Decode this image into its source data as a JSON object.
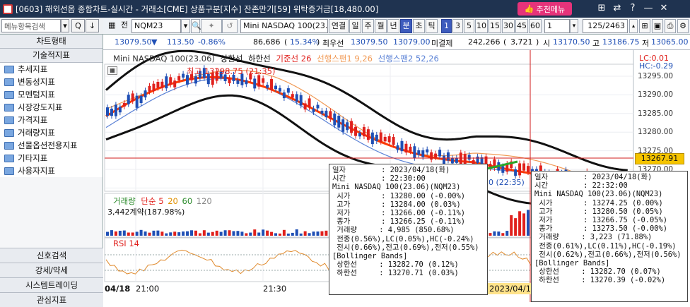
{
  "window": {
    "title": "[0603] 해외선옵 종합차트-실시간 - 거래소[CME] 상품구분[지수] 잔존만기[59] 위탁증거금[18,480.00]",
    "menu_button": "추천메뉴",
    "controls": [
      "⊞",
      "⇄",
      "?",
      "—",
      "✕"
    ]
  },
  "left_toolbar": {
    "search_placeholder": "메뉴항목검색",
    "buttons": [
      "▾",
      "Q",
      "↓"
    ]
  },
  "toolbar": {
    "type_label": "전",
    "symbol": "NQM23",
    "product_name": "Mini NASDAQ 100(23.06)",
    "period_buttons": [
      "연결",
      "일",
      "주",
      "월",
      "년",
      "분",
      "초",
      "틱"
    ],
    "selected_period": "분",
    "interval_buttons": [
      "1",
      "3",
      "5",
      "10",
      "15",
      "30",
      "45",
      "60"
    ],
    "selected_interval": "1",
    "interval_value": "1",
    "count": "125/2463"
  },
  "quote": {
    "price": "13079.50",
    "change": "113.50",
    "change_pct": "-0.86%",
    "volume": "86,686",
    "vol_ratio": "15.34%",
    "best_bid_label": "최우선",
    "best_bid": "13079.50",
    "best_ask": "13079.00",
    "open_interest_label": "미결제",
    "open_interest": "242,266",
    "oi_change": "3,721",
    "open_label": "시",
    "open": "13170.50",
    "high_label": "고",
    "high": "13186.75",
    "low_label": "저",
    "low": "13065.00"
  },
  "sidebar": {
    "header": "차트형태",
    "section": "기술적지표",
    "items": [
      "추세지표",
      "변동성지표",
      "모멘텀지표",
      "시장강도지표",
      "가격지표",
      "거래량지표",
      "선물옵션전용지표",
      "기타지표",
      "사용자지표"
    ],
    "bottom": [
      "신호검색",
      "강세/약세",
      "시스템트레이딩",
      "관심지표"
    ]
  },
  "chart": {
    "legend": {
      "product": "Mini NASDAQ 100(23.06)",
      "bb_upper": "상한선",
      "bb_lower": "하한선",
      "base_line": "기준선 26",
      "span1": "선행스팬1 9,26",
      "span2": "선행스팬2 52,26"
    },
    "high_label": "최고 13298.75 (21:35)",
    "low_label": "0 (22:35)",
    "lc": "LC:0.01",
    "hc": "HC:-0.29",
    "price_ticks": [
      "13295.00",
      "13290.00",
      "13285.00",
      "13280.00",
      "13275.00",
      "13270.00",
      "13265.00"
    ],
    "current_price": "13267.91",
    "volume_legend": {
      "name": "거래량",
      "ma1": "단순 5",
      "ma2": "20",
      "ma3": "60",
      "ma4": "120"
    },
    "volume_info": "3,442계약(187.98%)",
    "rsi_label": "RSI 14",
    "time_labels": [
      "04/18",
      "21:00",
      "21:30",
      "2023/04/18(화)"
    ],
    "colors": {
      "up": "#e0201c",
      "down": "#1f4fb5",
      "base": "#ff3c00",
      "ichimoku": "#f19a55",
      "span2": "#5b82d6"
    }
  },
  "tooltip_left": {
    "lines": [
      "일자        : 2023/04/18(화)",
      "시간        : 22:30:00",
      "Mini NASDAQ 100(23.06)(NQM23)",
      " 시가       : 13280.00 (-0.00%)",
      " 고가       : 13284.00 (0.03%)",
      " 저가       : 13266.00 (-0.11%)",
      " 종가       : 13266.25 (-0.11%)",
      " 거래량     : 4,985 (850.68%)",
      " 전종(0.56%),LC(0.05%),HC(-0.24%)",
      " 전시(0.66%),전고(0.69%),전저(0.55%)",
      "[Bollinger Bands]",
      " 상한선     : 13282.70 (0.12%)",
      " 하한선     : 13270.71 (0.03%)"
    ]
  },
  "tooltip_right": {
    "lines": [
      "일자        : 2023/04/18(화)",
      "시간        : 22:32:00",
      "Mini NASDAQ 100(23.06)(NQM23)",
      " 시가       : 13274.25 (0.00%)",
      " 고가       : 13280.50 (0.05%)",
      " 저가       : 13266.75 (-0.05%)",
      " 종가       : 13273.50 (-0.00%)",
      " 거래량     : 3,223 (71.88%)",
      " 전종(0.61%),LC(0.11%),HC(-0.19%)",
      " 전시(0.62%),전고(0.66%),전저(0.56%)",
      "[Bollinger Bands]",
      " 상한선     : 13282.70 (0.07%)",
      " 하한선     : 13270.39 (-0.02%)"
    ]
  }
}
